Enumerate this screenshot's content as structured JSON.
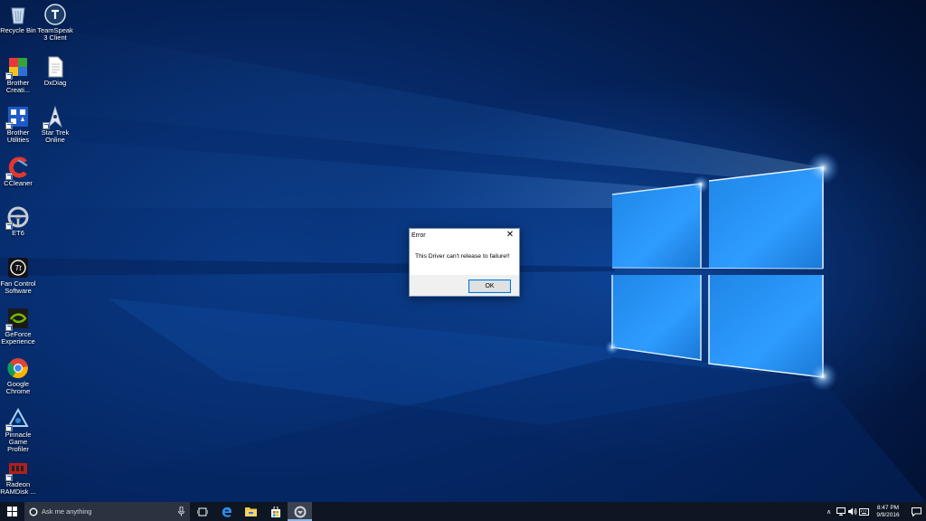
{
  "desktop": {
    "icons": [
      {
        "id": "recycle-bin",
        "label": "Recycle Bin"
      },
      {
        "id": "teamspeak",
        "label": "TeamSpeak 3 Client"
      },
      {
        "id": "brother-creative",
        "label": "Brother Creati..."
      },
      {
        "id": "dxdiag",
        "label": "DxDiag"
      },
      {
        "id": "brother-utilities",
        "label": "Brother Utilities"
      },
      {
        "id": "star-trek-online",
        "label": "Star Trek Online"
      },
      {
        "id": "ccleaner",
        "label": "CCleaner"
      },
      {
        "id": "et6",
        "label": "ET6"
      },
      {
        "id": "fan-control",
        "label": "Fan Control Software"
      },
      {
        "id": "geforce-experience",
        "label": "GeForce Experience"
      },
      {
        "id": "google-chrome",
        "label": "Google Chrome"
      },
      {
        "id": "pinnacle",
        "label": "Pinnacle Game Profiler"
      },
      {
        "id": "radeon-ramdisk",
        "label": "Radeon RAMDisk ..."
      }
    ]
  },
  "dialog": {
    "title": "Error",
    "close_glyph": "✕",
    "message": "This Driver can't release to failure!!",
    "ok_label": "OK"
  },
  "taskbar": {
    "search_placeholder": "Ask me anything",
    "tray": {
      "chevron": "∧",
      "time": "8:47 PM",
      "date": "9/9/2016"
    }
  },
  "colors": {
    "taskbar_bg": "#0e1623",
    "accent": "#0078d7",
    "wallpaper_blue": "#0a3a86"
  }
}
